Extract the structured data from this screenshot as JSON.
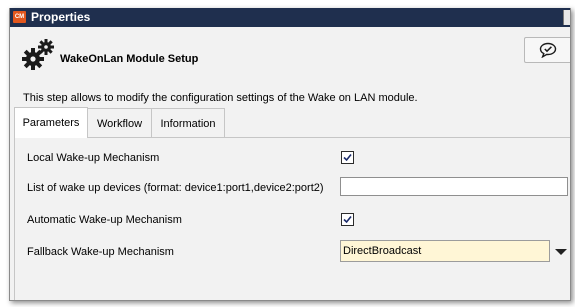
{
  "window": {
    "title": "Properties",
    "app_icon_text": "CM"
  },
  "header": {
    "module_title": "WakeOnLan Module Setup",
    "description": "This step allows to modify the configuration settings of the Wake on LAN module.",
    "gear_icon": "gears-icon",
    "feedback_icon": "chat-check-icon"
  },
  "tabs": [
    {
      "label": "Parameters",
      "active": true
    },
    {
      "label": "Workflow",
      "active": false
    },
    {
      "label": "Information",
      "active": false
    }
  ],
  "parameters": {
    "local_wakeup": {
      "label": "Local Wake-up Mechanism",
      "checked": true
    },
    "device_list": {
      "label": "List of wake up devices (format: device1:port1,device2:port2)",
      "value": ""
    },
    "auto_wakeup": {
      "label": "Automatic Wake-up Mechanism",
      "checked": true
    },
    "fallback": {
      "label": "Fallback Wake-up Mechanism",
      "selected": "DirectBroadcast"
    }
  },
  "colors": {
    "titlebar": "#1f2f4e",
    "app_icon": "#e2571e",
    "select_bg": "#fff6d6",
    "panel_bg": "#f2f2f2"
  }
}
